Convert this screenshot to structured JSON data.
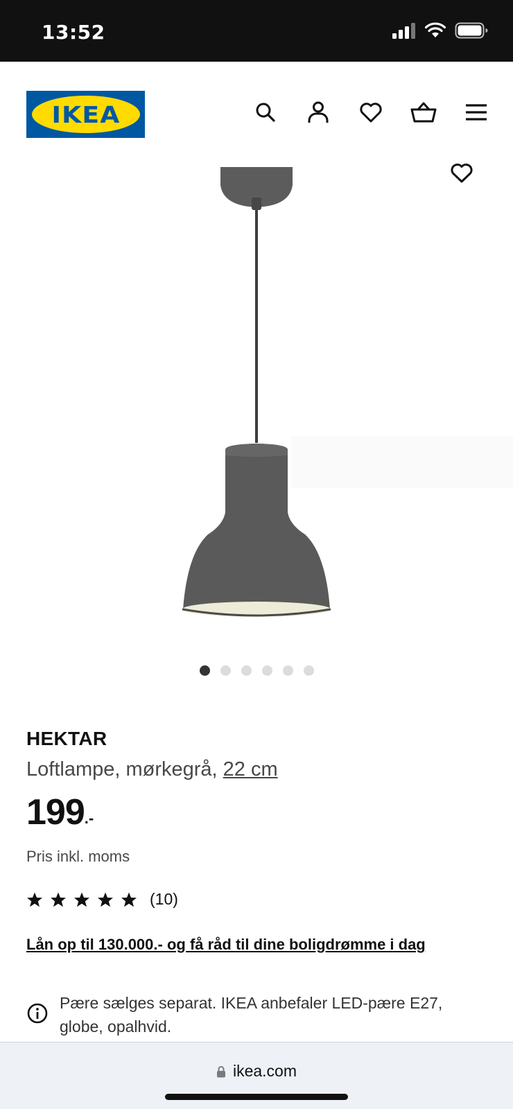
{
  "status_bar": {
    "time": "13:52"
  },
  "brand": {
    "logo_text": "IKEA"
  },
  "product": {
    "name": "HEKTAR",
    "description": "Loftlampe, mørkegrå, ",
    "size": "22 cm",
    "price_integer": "199",
    "price_suffix": ".-",
    "price_note": "Pris inkl. moms",
    "rating_value": 5,
    "rating_max": 5,
    "rating_count": "(10)",
    "image_count": 6,
    "current_image": 1
  },
  "loan_link": "Lån op til 130.000.- og få råd til dine boligdrømme i dag",
  "info_text": "Pære sælges separat. IKEA anbefaler LED-pære E27, globe, opalhvid.",
  "browser": {
    "url": "ikea.com"
  },
  "colors": {
    "brand_blue": "#0058a3",
    "brand_yellow": "#ffdb00",
    "lamp_gray": "#5c5c5c"
  }
}
